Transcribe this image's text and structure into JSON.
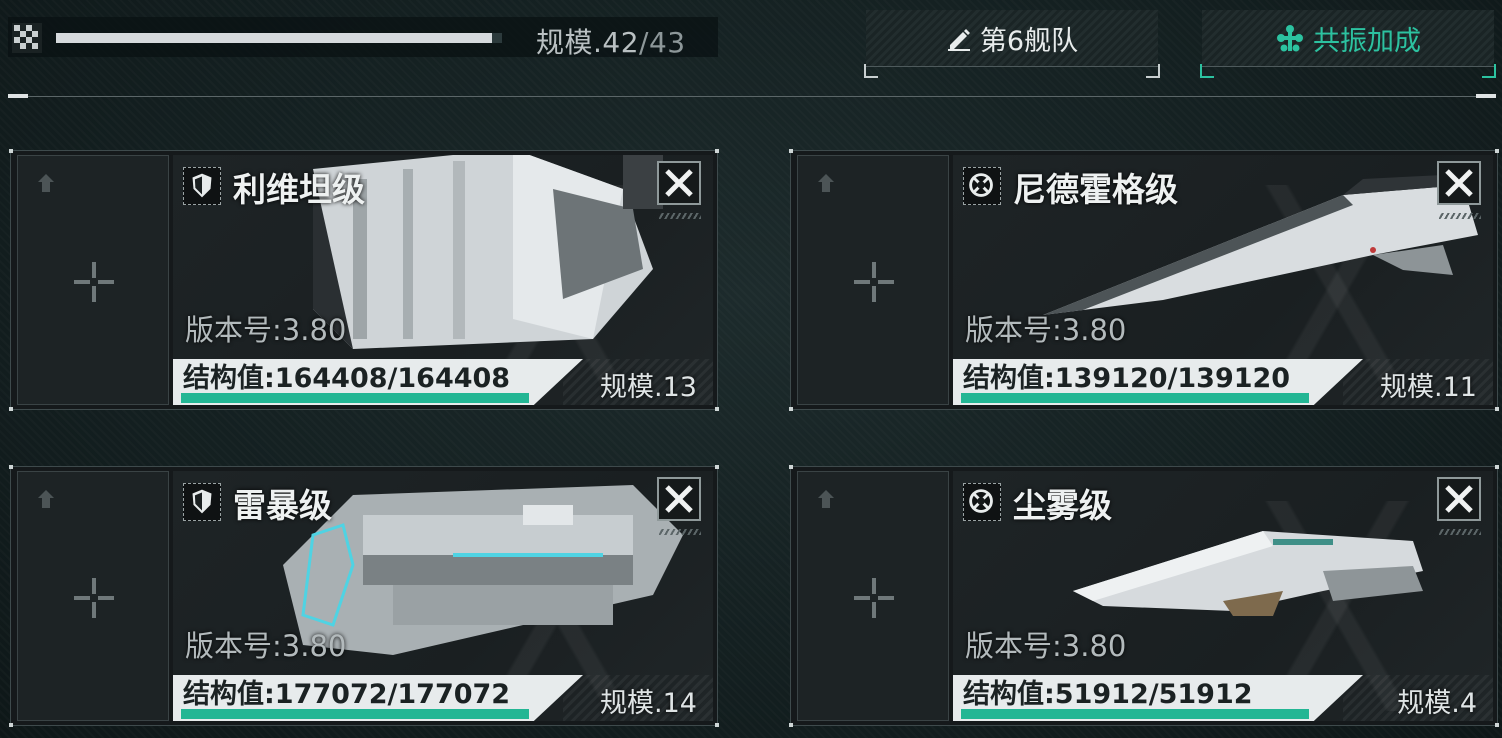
{
  "header": {
    "capacity_label": "规模.",
    "capacity_current": "42",
    "capacity_max": "/43",
    "capacity_fraction": 0.977,
    "fleet_button_label": "第6舰队",
    "fleet_button_icon": "pencil-icon",
    "resonance_button_label": "共振加成",
    "resonance_button_icon": "resonance-icon",
    "accent_color": "#2cc2a0"
  },
  "ships": [
    {
      "name": "利维坦级",
      "role_icon": "shield-icon",
      "version": "版本号:3.80",
      "hp": "结构值:164408/164408",
      "hp_fraction": 1.0,
      "scale": "规模.13"
    },
    {
      "name": "尼德霍格级",
      "role_icon": "target-icon",
      "version": "版本号:3.80",
      "hp": "结构值:139120/139120",
      "hp_fraction": 1.0,
      "scale": "规模.11"
    },
    {
      "name": "雷暴级",
      "role_icon": "shield-icon",
      "version": "版本号:3.80",
      "hp": "结构值:177072/177072",
      "hp_fraction": 1.0,
      "scale": "规模.14"
    },
    {
      "name": "尘雾级",
      "role_icon": "target-icon",
      "version": "版本号:3.80",
      "hp": "结构值:51912/51912",
      "hp_fraction": 1.0,
      "scale": "规模.4"
    }
  ]
}
